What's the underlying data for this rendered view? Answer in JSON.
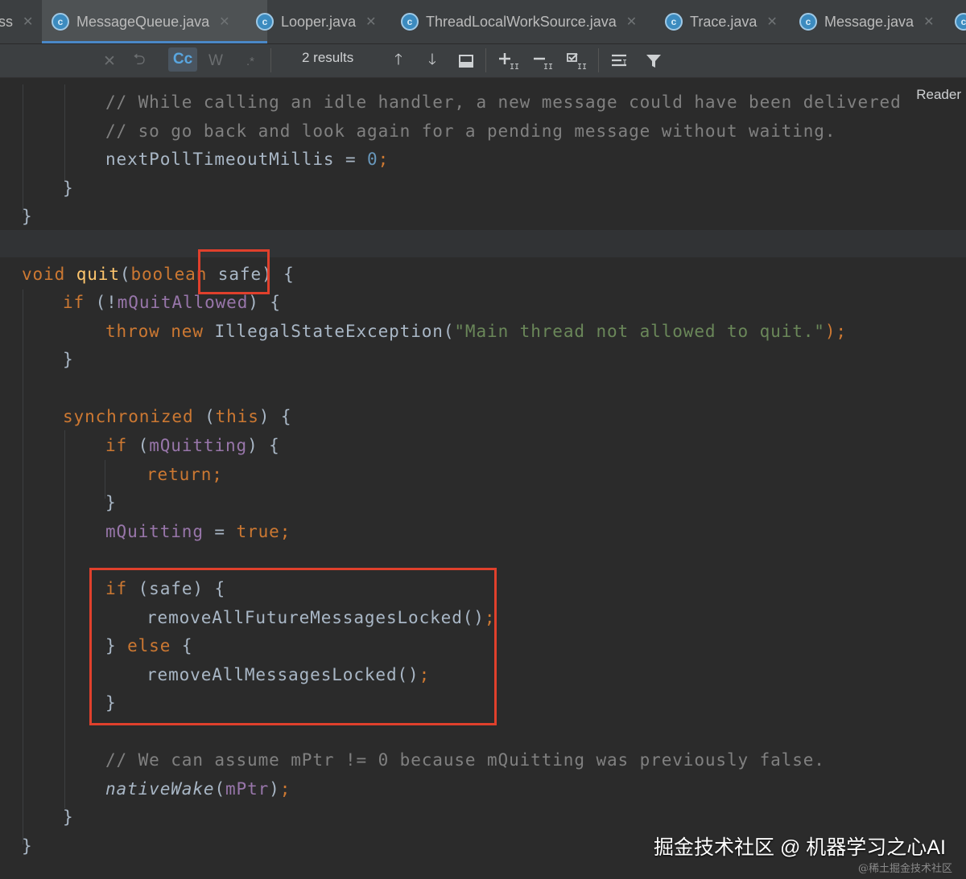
{
  "tabs": [
    {
      "label": "ss",
      "icon": "java-class-icon",
      "active": false,
      "partial": true
    },
    {
      "label": "MessageQueue.java",
      "icon": "java-class-icon",
      "active": true
    },
    {
      "label": "Looper.java",
      "icon": "java-class-icon",
      "active": false
    },
    {
      "label": "ThreadLocalWorkSource.java",
      "icon": "java-class-icon",
      "active": false
    },
    {
      "label": "Trace.java",
      "icon": "java-class-icon",
      "active": false
    },
    {
      "label": "Message.java",
      "icon": "java-class-icon",
      "active": false
    }
  ],
  "search": {
    "results_label": "2 results",
    "match_case_label": "Cc",
    "words_label": "W",
    "regex_label": ".*"
  },
  "reader_label": "Reader",
  "code": {
    "line1": "// While calling an idle handler, a new message could have been delivered",
    "line2": "// so go back and look again for a pending message without waiting.",
    "line3_a": "nextPollTimeoutMillis = ",
    "line3_num": "0",
    "line3_end": ";",
    "brace_close": "}",
    "quit_kw": "void ",
    "quit_name": "quit",
    "quit_paren": "(",
    "quit_type": "boolean",
    "quit_param": " safe)",
    "quit_open": " {",
    "if_kw": "if ",
    "if_cond_a": "(!",
    "if_cond_fld": "mQuitAllowed",
    "if_cond_b": ") {",
    "throw_kw": "throw new ",
    "throw_cls": "IllegalStateException(",
    "throw_str": "\"Main thread not allowed to quit.\"",
    "throw_end": ");",
    "sync_kw": "synchronized ",
    "sync_a": "(",
    "sync_this": "this",
    "sync_b": ") {",
    "ifq_a": "(",
    "ifq_fld": "mQuitting",
    "ifq_b": ") {",
    "return_kw": "return",
    "semi": ";",
    "mq_fld": "mQuitting",
    "mq_eq": " = ",
    "true_kw": "true",
    "ifsafe": "(safe) {",
    "remove_future": "removeAllFutureMessagesLocked()",
    "else_a": "} ",
    "else_kw": "else",
    "else_b": " {",
    "remove_all": "removeAllMessagesLocked()",
    "comment_assume": "// We can assume mPtr != 0 because mQuitting was previously false.",
    "native_fn": "nativeWake",
    "native_a": "(",
    "native_fld": "mPtr",
    "native_b": ")"
  },
  "watermark": "掘金技术社区 @ 机器学习之心AI",
  "watermark_small": "@稀土掘金技术社区"
}
